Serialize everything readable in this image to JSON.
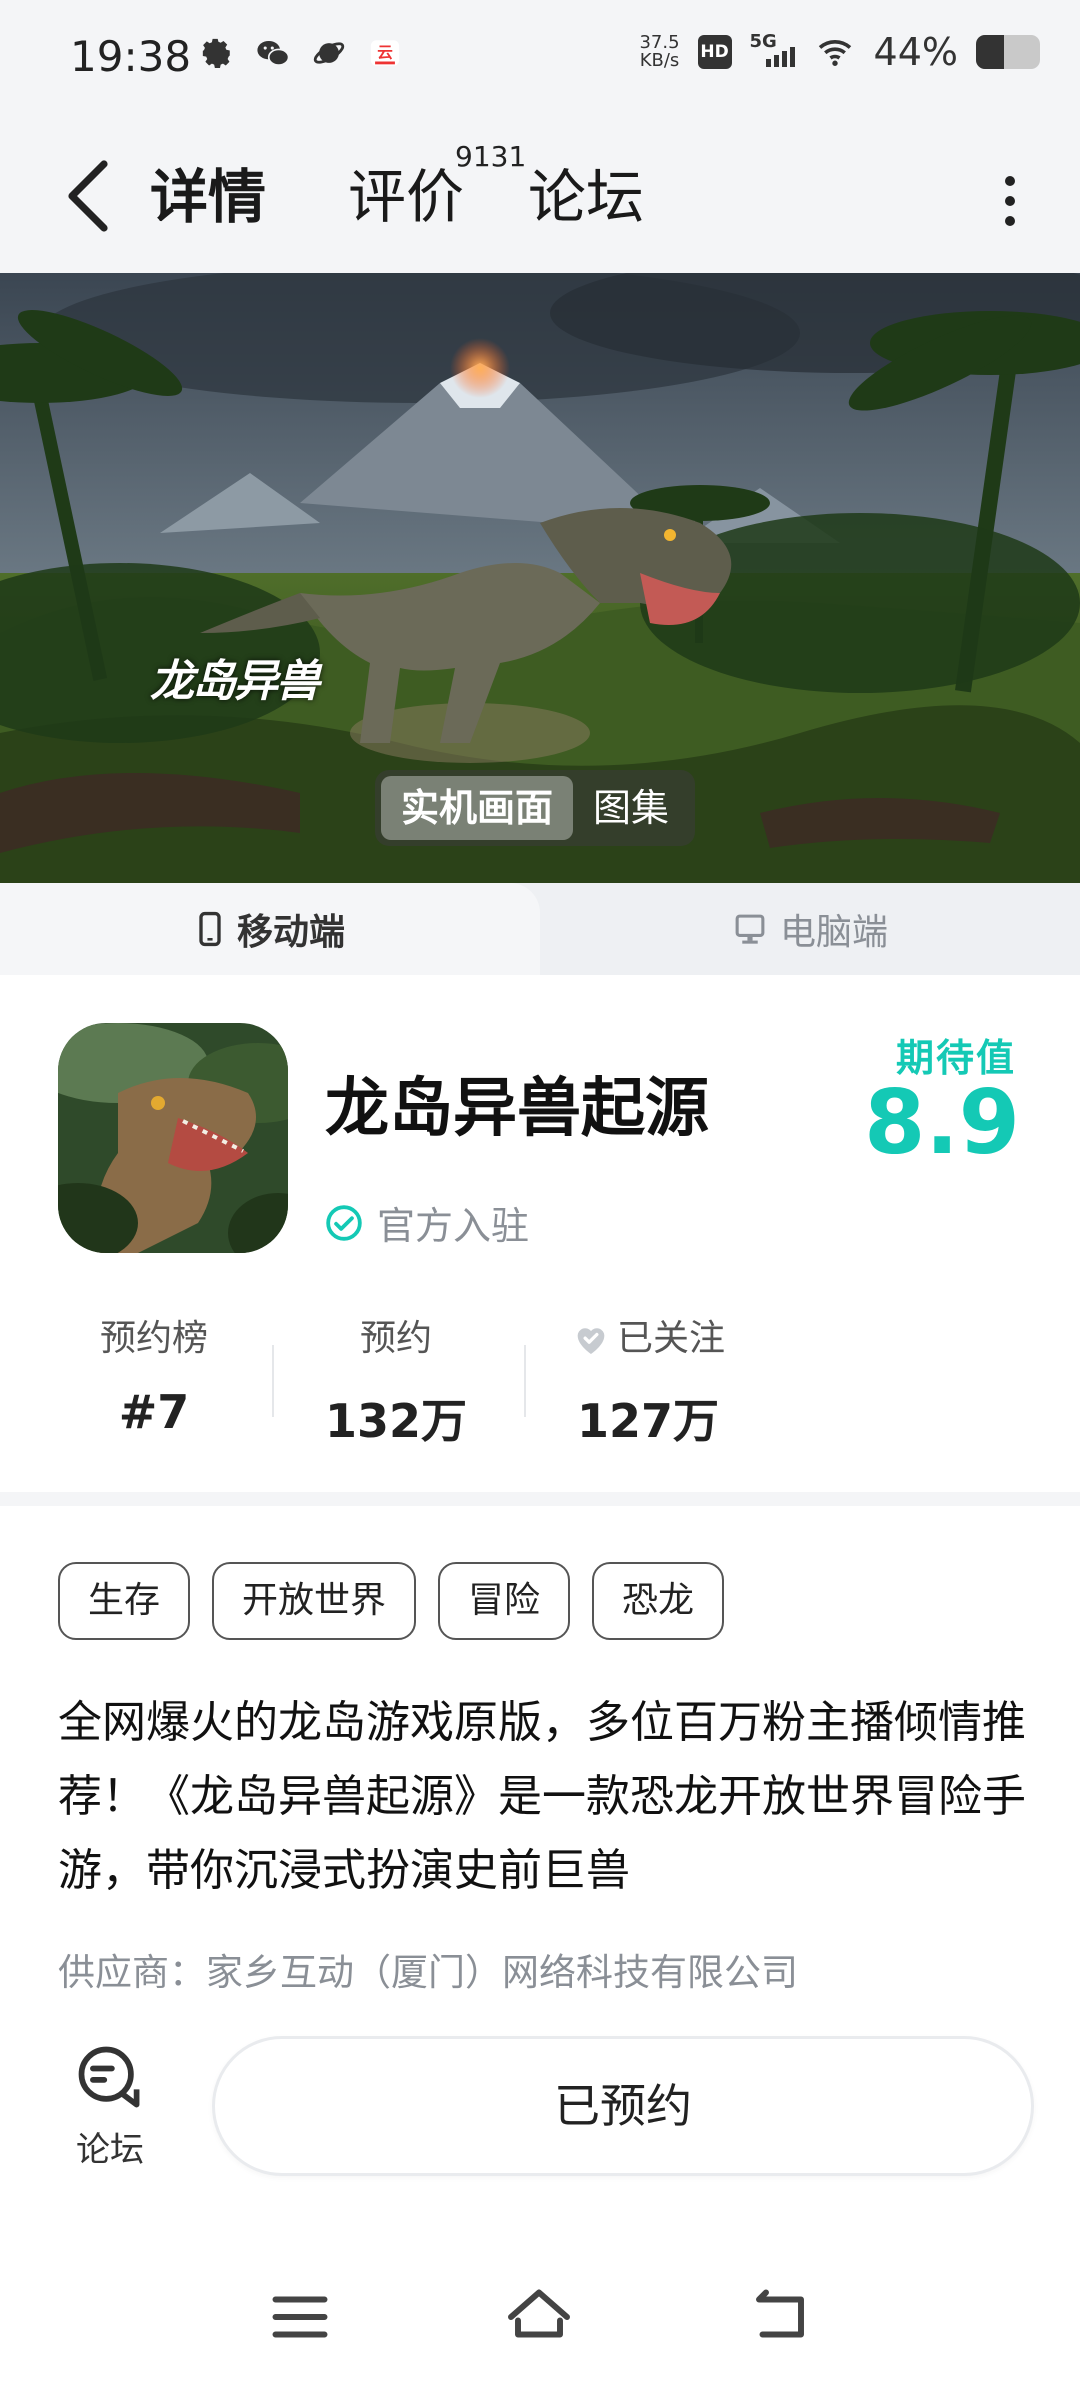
{
  "status_bar": {
    "time": "19:38",
    "net_speed_value": "37.5",
    "net_speed_unit": "KB/s",
    "hd_label": "HD",
    "network_label": "5G",
    "battery_percent": "44%",
    "battery_level": 0.44,
    "icons": [
      "gear-icon",
      "wechat-icon",
      "planet-icon",
      "cloud-app-icon",
      "wifi-icon"
    ]
  },
  "nav": {
    "tabs": [
      {
        "label": "详情",
        "active": true
      },
      {
        "label": "评价",
        "count": "9131"
      },
      {
        "label": "论坛"
      }
    ],
    "icons": [
      "back-arrow-icon",
      "more-vertical-icon"
    ]
  },
  "banner": {
    "logo_text": "龙岛异兽",
    "media_tabs": [
      {
        "label": "实机画面",
        "active": true
      },
      {
        "label": "图集"
      }
    ]
  },
  "platforms": {
    "mobile": "移动端",
    "pc": "电脑端",
    "selected": "mobile"
  },
  "game": {
    "title": "龙岛异兽起源",
    "official_label": "官方入驻",
    "expect_label": "期待值",
    "expect_value": "8.9",
    "stats": [
      {
        "label": "预约榜",
        "value": "#7"
      },
      {
        "label": "预约",
        "value": "132万"
      },
      {
        "label": "已关注",
        "value": "127万"
      }
    ]
  },
  "tags": [
    "生存",
    "开放世界",
    "冒险",
    "恐龙"
  ],
  "description": "全网爆火的龙岛游戏原版，多位百万粉主播倾情推荐！《龙岛异兽起源》是一款恐龙开放世界冒险手游，带你沉浸式扮演史前巨兽",
  "supplier": "供应商：家乡互动（厦门）网络科技有限公司",
  "bottom_bar": {
    "forum_label": "论坛",
    "reserve_button": "已预约"
  },
  "colors": {
    "accent": "#14c9b5",
    "underline": "#14d7c2",
    "page_bg": "#f4f5f7"
  }
}
